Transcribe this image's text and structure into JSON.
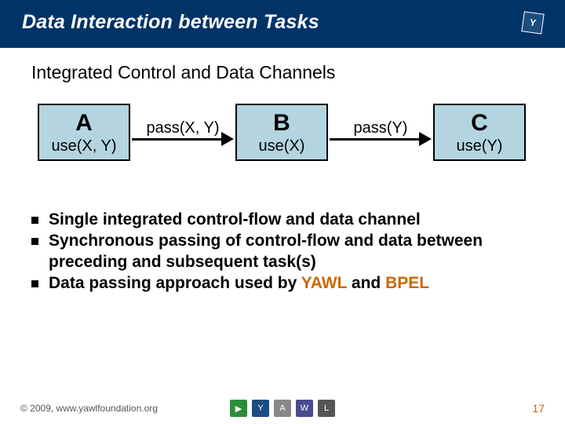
{
  "header": {
    "title": "Data Interaction between Tasks",
    "logo_text": "Y"
  },
  "subtitle": "Integrated Control and Data Channels",
  "diagram": {
    "nodes": [
      {
        "name": "A",
        "use": "use(X, Y)"
      },
      {
        "name": "B",
        "use": "use(X)"
      },
      {
        "name": "C",
        "use": "use(Y)"
      }
    ],
    "edges": [
      {
        "label": "pass(X, Y)"
      },
      {
        "label": "pass(Y)"
      }
    ]
  },
  "bullets": {
    "items": [
      "Single integrated control-flow and data channel",
      "Synchronous passing of control-flow and data between preceding and subsequent task(s)",
      "Data passing approach used by "
    ],
    "highlight1": "YAWL",
    "and": " and ",
    "highlight2": "BPEL"
  },
  "footer": {
    "copyright": "© 2009, www.yawlfoundation.org",
    "page": "17",
    "logo_glyphs": [
      "▶",
      "Y",
      "A",
      "W",
      "L"
    ]
  }
}
